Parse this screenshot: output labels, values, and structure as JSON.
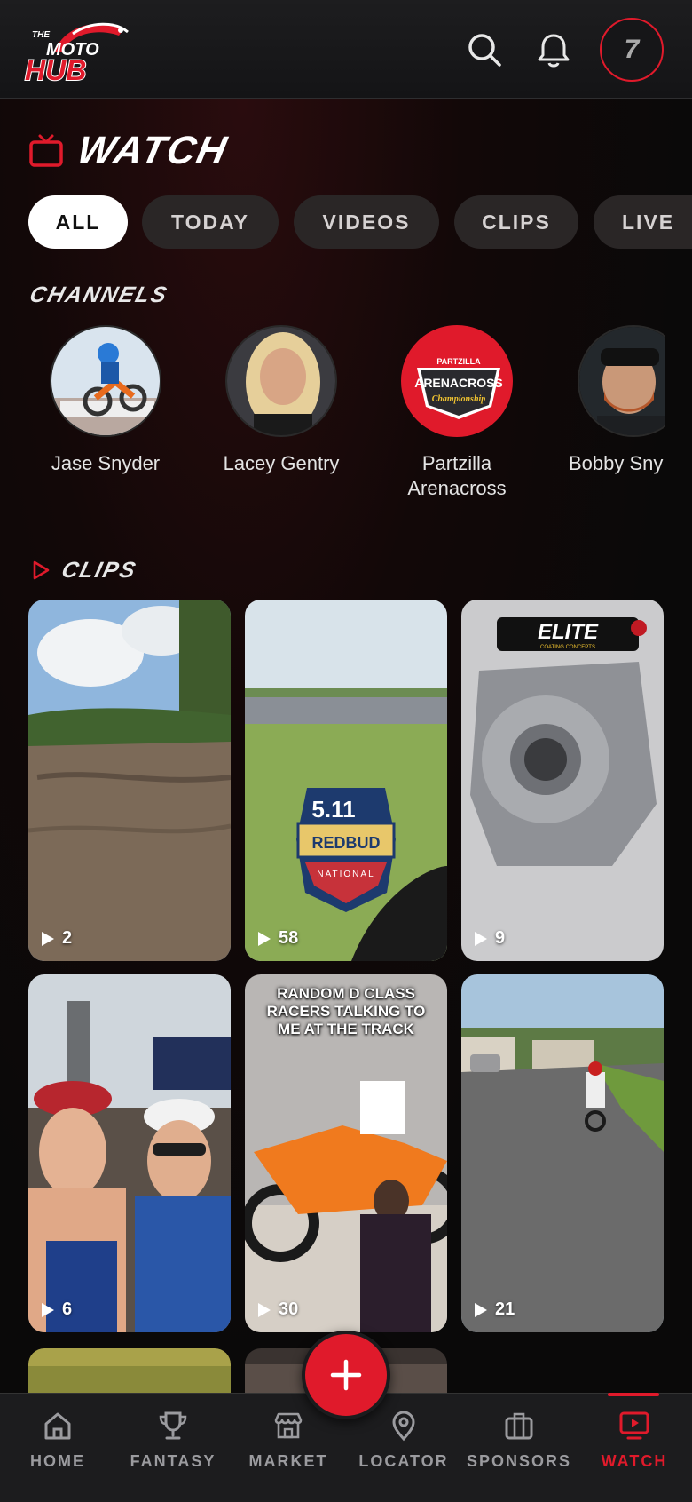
{
  "header": {
    "logo_small": "THE",
    "logo_main": "MOTO",
    "logo_sub": "HUB",
    "avatar_initial": "7"
  },
  "watch": {
    "title": "WATCH",
    "filters": [
      {
        "label": "ALL",
        "active": true
      },
      {
        "label": "TODAY",
        "active": false
      },
      {
        "label": "VIDEOS",
        "active": false
      },
      {
        "label": "CLIPS",
        "active": false
      },
      {
        "label": "LIVE",
        "active": false
      }
    ]
  },
  "channels": {
    "title": "CHANNELS",
    "items": [
      {
        "name": "Jase Snyder"
      },
      {
        "name": "Lacey Gentry"
      },
      {
        "name": "Partzilla Arenacross",
        "name_line1": "Partzilla",
        "name_line2": "Arenacross",
        "logo_lines": [
          "PARTZILLA",
          "ARENACROSS",
          "Championship"
        ]
      },
      {
        "name": "Bobby Sny"
      }
    ]
  },
  "clips": {
    "title": "CLIPS",
    "items": [
      {
        "views": "2"
      },
      {
        "views": "58",
        "badge_lines": [
          "5.11",
          "REDBUD",
          "NATIONAL"
        ]
      },
      {
        "views": "9",
        "badge_lines": [
          "ELITE",
          "COATING CONCEPTS"
        ]
      },
      {
        "views": "6"
      },
      {
        "views": "30",
        "caption": "RANDOM D CLASS RACERS TALKING TO ME AT THE TRACK"
      },
      {
        "views": "21"
      }
    ]
  },
  "nav": {
    "items": [
      {
        "label": "HOME",
        "icon": "home-icon"
      },
      {
        "label": "FANTASY",
        "icon": "trophy-icon"
      },
      {
        "label": "MARKET",
        "icon": "store-icon"
      },
      {
        "label": "LOCATOR",
        "icon": "location-pin-icon"
      },
      {
        "label": "SPONSORS",
        "icon": "briefcase-icon"
      },
      {
        "label": "WATCH",
        "icon": "play-screen-icon",
        "active": true
      }
    ]
  },
  "colors": {
    "accent": "#e01a2b",
    "background": "#0b0a0a",
    "nav_background": "#1c1c1e"
  }
}
